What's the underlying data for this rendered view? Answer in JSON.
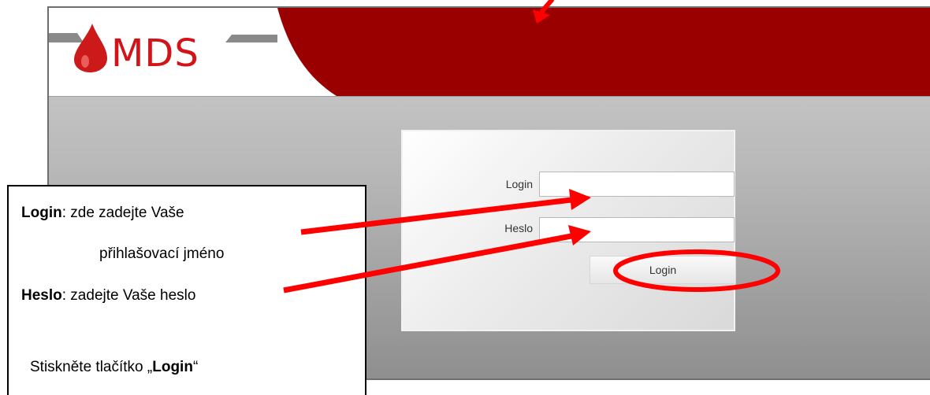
{
  "app": {
    "logo_text": "MDS",
    "colors": {
      "brand_red": "#9b0000",
      "logo_red": "#d3131a",
      "logo_gray": "#8a8a8a"
    }
  },
  "form": {
    "login_label": "Login",
    "login_value": "",
    "heslo_label": "Heslo",
    "heslo_value": "",
    "submit_label": "Login"
  },
  "annotation": {
    "line1_bold": "Login",
    "line1_rest": ": zde zadejte Vaše",
    "line2": "přihlašovací jméno",
    "line3_bold": "Heslo",
    "line3_rest": ": zadejte Vaše heslo",
    "line4_before": "Stiskněte tlačítko „",
    "line4_bold": "Login",
    "line4_after": "“",
    "arrow_color": "#ff0000"
  }
}
